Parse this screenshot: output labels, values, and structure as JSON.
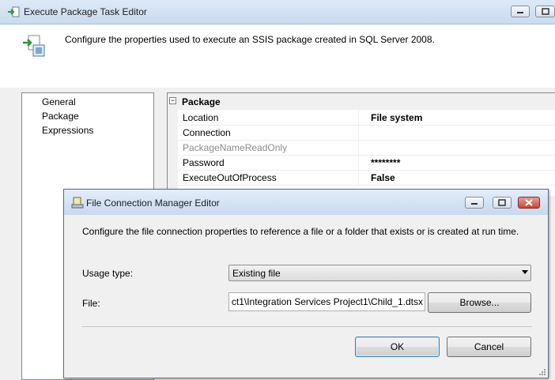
{
  "outer_window": {
    "title": "Execute Package Task Editor",
    "header_text": "Configure the properties used to execute an SSIS package created in SQL Server 2008."
  },
  "nav": {
    "items": [
      {
        "label": "General"
      },
      {
        "label": "Package"
      },
      {
        "label": "Expressions"
      }
    ]
  },
  "property_grid": {
    "category": "Package",
    "rows": [
      {
        "name": "Location",
        "value": "File system",
        "disabled": false
      },
      {
        "name": "Connection",
        "value": "",
        "disabled": false
      },
      {
        "name": "PackageNameReadOnly",
        "value": "",
        "disabled": true
      },
      {
        "name": "Password",
        "value": "********",
        "disabled": false
      },
      {
        "name": "ExecuteOutOfProcess",
        "value": "False",
        "disabled": false
      }
    ]
  },
  "dialog": {
    "title": "File Connection Manager Editor",
    "description": "Configure the file connection properties to reference a file or a folder that exists or is created at run time.",
    "usage_type_label": "Usage type:",
    "usage_type_value": "Existing file",
    "file_label": "File:",
    "file_value": "ct1\\Integration Services Project1\\Child_1.dtsx",
    "browse_label": "Browse...",
    "ok_label": "OK",
    "cancel_label": "Cancel"
  },
  "icons": {
    "outer_title": "package-task-icon",
    "header": "package-task-icon",
    "dialog_title": "file-connection-icon"
  },
  "colors": {
    "titlebar": "#c9dbef",
    "close_button": "#c9463a",
    "default_button_border": "#3c7fb1"
  }
}
